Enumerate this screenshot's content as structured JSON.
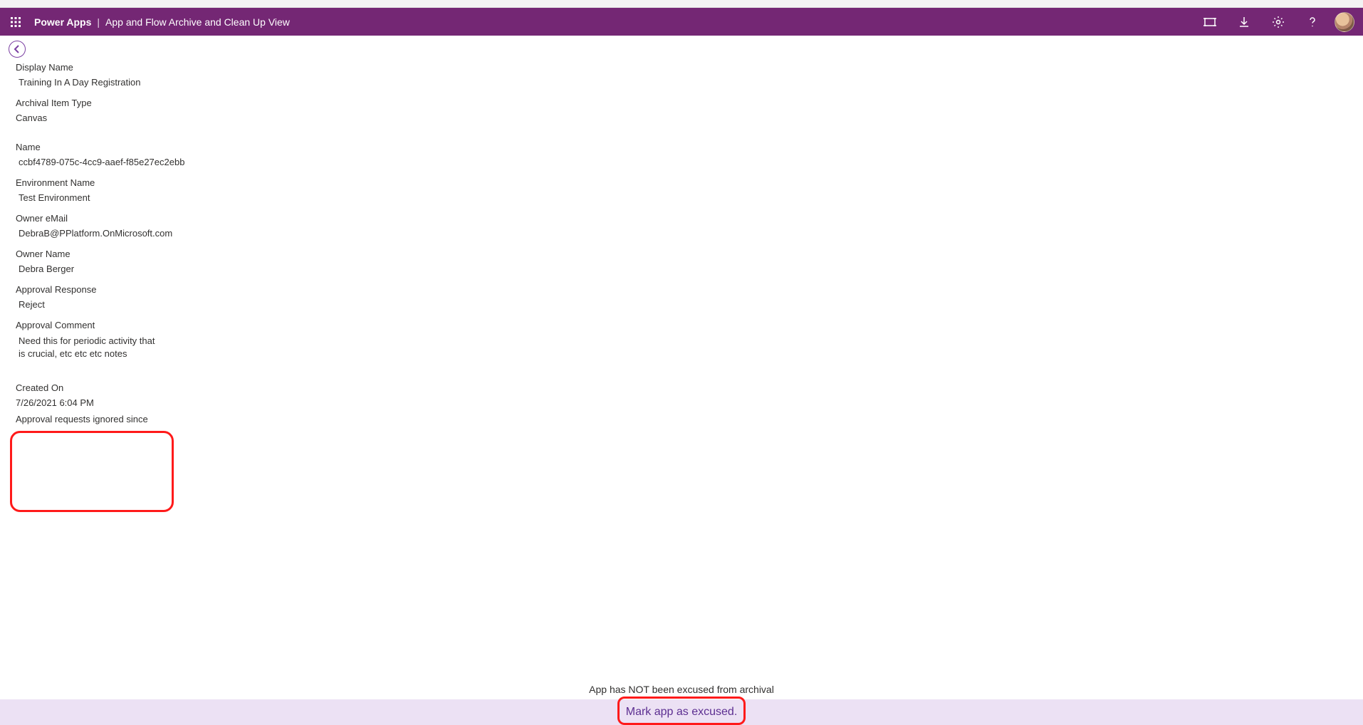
{
  "header": {
    "brand": "Power Apps",
    "separator": "|",
    "view": "App and Flow Archive and Clean Up View"
  },
  "fields": {
    "displayName": {
      "label": "Display Name",
      "value": "Training In A Day Registration"
    },
    "archivalItemType": {
      "label": "Archival Item Type",
      "value": "Canvas"
    },
    "name": {
      "label": "Name",
      "value": "ccbf4789-075c-4cc9-aaef-f85e27ec2ebb"
    },
    "environmentName": {
      "label": "Environment Name",
      "value": "Test Environment"
    },
    "ownerEmail": {
      "label": "Owner eMail",
      "value": "DebraB@PPlatform.OnMicrosoft.com"
    },
    "ownerName": {
      "label": "Owner Name",
      "value": "Debra Berger"
    },
    "approvalResponse": {
      "label": "Approval Response",
      "value": "Reject"
    },
    "approvalComment": {
      "label": "Approval Comment",
      "value": "Need this for periodic activity that is crucial, etc etc etc notes"
    },
    "createdOn": {
      "label": "Created On",
      "value": "7/26/2021 6:04 PM"
    },
    "approvalIgnoredSince": {
      "label": "Approval requests ignored since",
      "value": ""
    }
  },
  "status": {
    "message": "App has NOT been excused from archival"
  },
  "footer": {
    "excuseLabel": "Mark app as excused."
  }
}
